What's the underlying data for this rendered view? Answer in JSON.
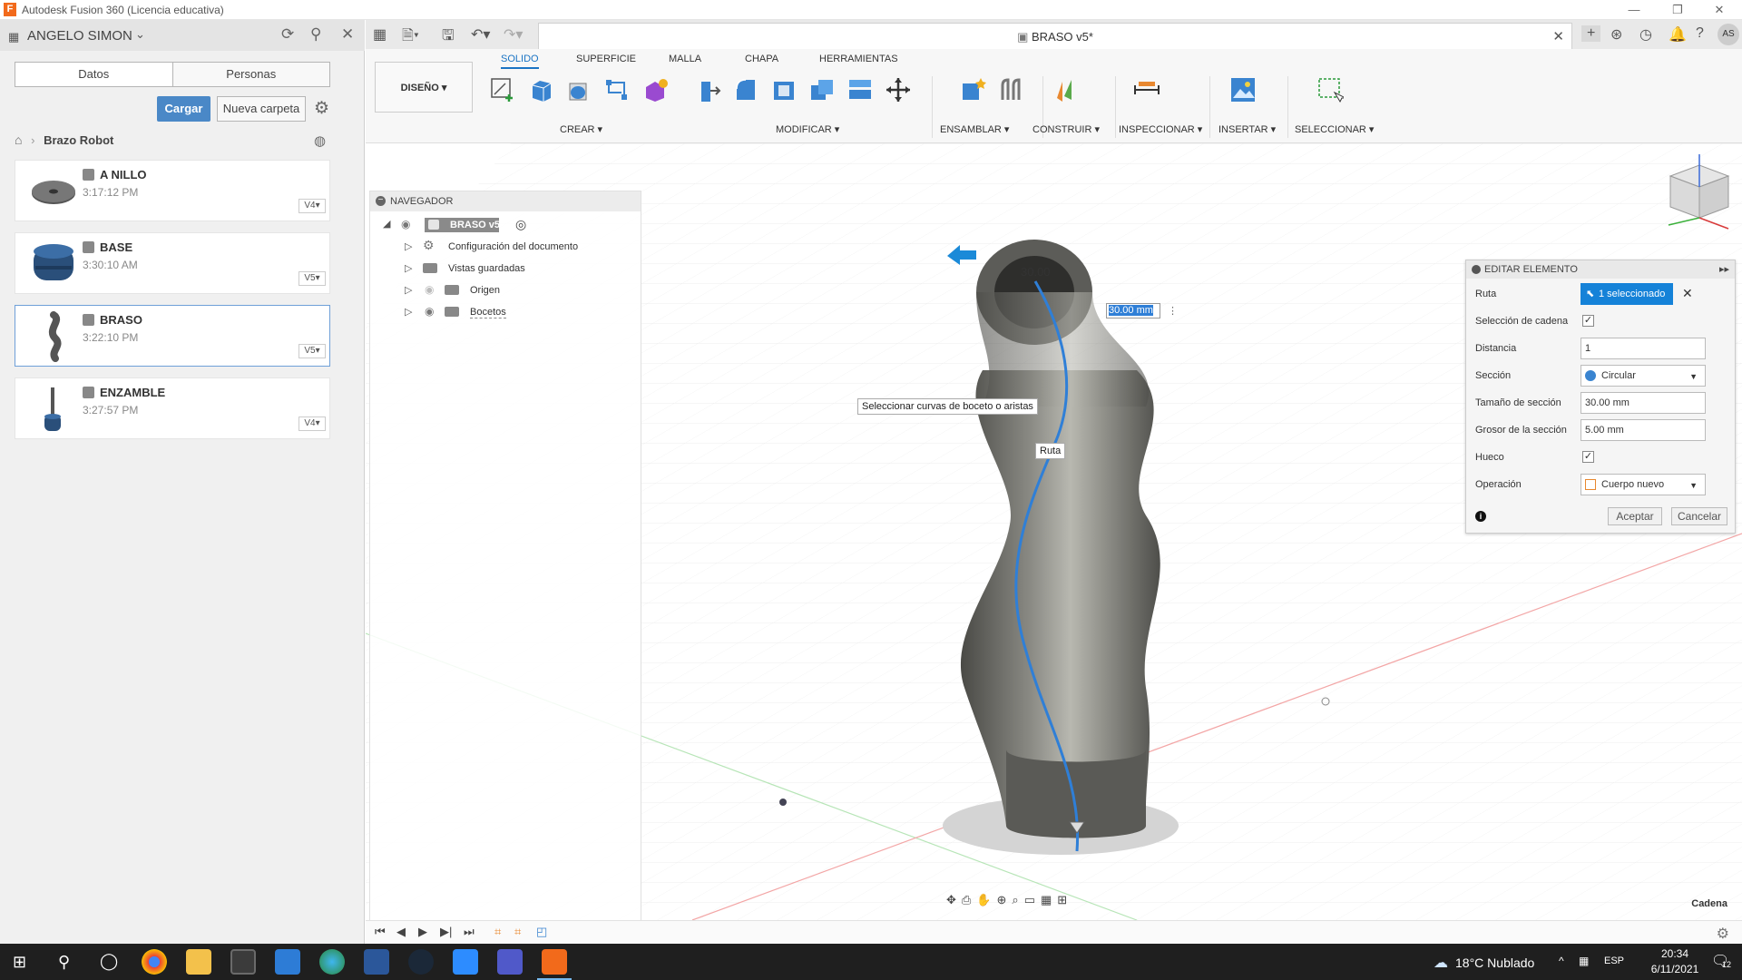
{
  "window": {
    "title": "Autodesk Fusion 360 (Licencia educativa)",
    "logo": "F"
  },
  "leftpanel": {
    "user": "ANGELO SIMON",
    "tabs": [
      "Datos",
      "Personas"
    ],
    "upload_label": "Cargar",
    "new_folder_label": "Nueva carpeta",
    "breadcrumb": "Brazo Robot",
    "files": [
      {
        "name": "A NILLO",
        "time": "3:17:12 PM",
        "version": "V4▾"
      },
      {
        "name": "BASE",
        "time": "3:30:10 AM",
        "version": "V5▾"
      },
      {
        "name": "BRASO",
        "time": "3:22:10 PM",
        "version": "V5▾"
      },
      {
        "name": "ENZAMBLE",
        "time": "3:27:57 PM",
        "version": "V4▾"
      }
    ]
  },
  "document": {
    "tab_title": "BRASO v5*",
    "user_initials": "AS"
  },
  "toolbar": {
    "workspace": "DISEÑO ▾",
    "tabs": [
      "SOLIDO",
      "SUPERFICIE",
      "MALLA",
      "CHAPA",
      "HERRAMIENTAS"
    ],
    "groups": [
      "CREAR ▾",
      "MODIFICAR ▾",
      "ENSAMBLAR ▾",
      "CONSTRUIR ▾",
      "INSPECCIONAR ▾",
      "INSERTAR ▾",
      "SELECCIONAR ▾"
    ]
  },
  "navigator": {
    "title": "NAVEGADOR",
    "root": "BRASO v5",
    "items": [
      "Configuración del documento",
      "Vistas guardadas",
      "Origen",
      "Bocetos"
    ]
  },
  "viewport": {
    "tooltip": "Seleccionar curvas de boceto o aristas",
    "path_label": "Ruta",
    "dimension_value": "30.00 mm",
    "ring_label": "30.00",
    "status": "Cadena"
  },
  "editpanel": {
    "title": "EDITAR ELEMENTO",
    "rows": [
      {
        "label": "Ruta",
        "value": "1 seleccionado"
      },
      {
        "label": "Selección de cadena",
        "value": "✓"
      },
      {
        "label": "Distancia",
        "value": "1"
      },
      {
        "label": "Sección",
        "value": "Circular"
      },
      {
        "label": "Tamaño de sección",
        "value": "30.00 mm"
      },
      {
        "label": "Grosor de la sección",
        "value": "5.00 mm"
      },
      {
        "label": "Hueco",
        "value": "✓"
      },
      {
        "label": "Operación",
        "value": "Cuerpo nuevo"
      }
    ],
    "ok": "Aceptar",
    "cancel": "Cancelar"
  },
  "taskbar": {
    "weather": "18°C Nublado",
    "lang": "ESP",
    "time": "20:34",
    "date": "6/11/2021",
    "notifications": "12"
  },
  "colors": {
    "accent": "#1582d8",
    "brand": "#f26a1b",
    "path": "#2f7fd7"
  }
}
